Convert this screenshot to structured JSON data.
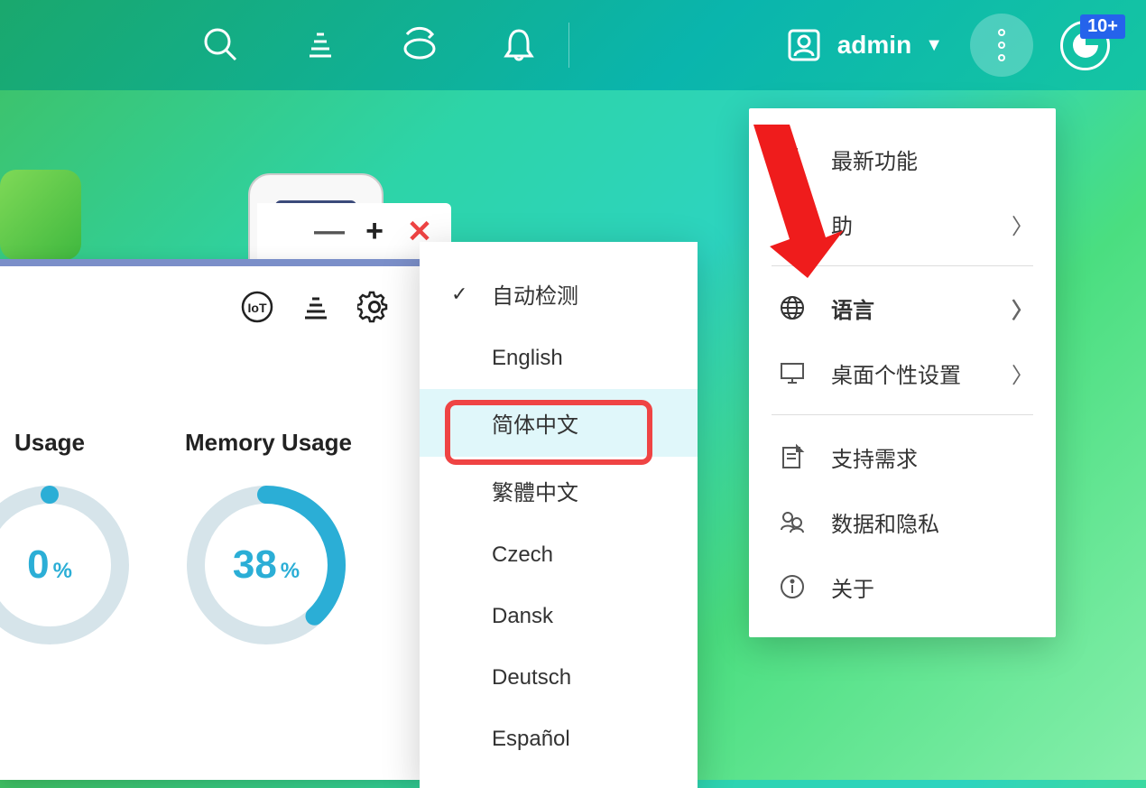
{
  "topbar": {
    "user_name": "admin",
    "notification_badge": "10+"
  },
  "main_menu": {
    "items": [
      {
        "label": "最新功能",
        "has_chevron": false
      },
      {
        "label": "助",
        "has_chevron": true
      },
      {
        "label": "语言",
        "has_chevron": true,
        "bold": true
      },
      {
        "label": "桌面个性设置",
        "has_chevron": true
      },
      {
        "label": "支持需求",
        "has_chevron": false
      },
      {
        "label": "数据和隐私",
        "has_chevron": false
      },
      {
        "label": "关于",
        "has_chevron": false
      }
    ]
  },
  "language_menu": {
    "items": [
      {
        "label": "自动检测",
        "checked": true
      },
      {
        "label": "English"
      },
      {
        "label": "简体中文",
        "selected": true
      },
      {
        "label": "繁體中文"
      },
      {
        "label": "Czech"
      },
      {
        "label": "Dansk"
      },
      {
        "label": "Deutsch"
      },
      {
        "label": "Español"
      }
    ]
  },
  "dashboard": {
    "gauges": [
      {
        "label": "Usage",
        "value": "0",
        "percent": 0
      },
      {
        "label": "Memory Usage",
        "value": "38",
        "percent": 38
      }
    ]
  }
}
